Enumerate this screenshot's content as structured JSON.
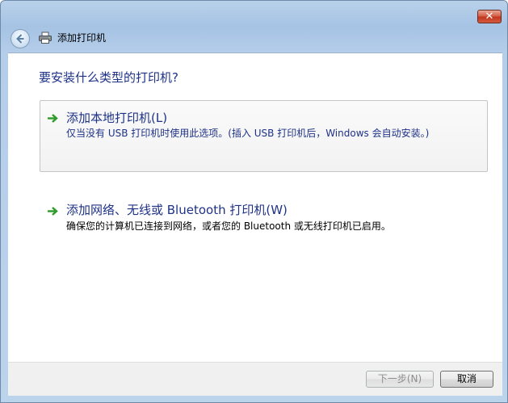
{
  "window": {
    "title": "添加打印机",
    "close_glyph": "✕"
  },
  "icons": {
    "back": "back-arrow-icon",
    "printer": "printer-icon",
    "option_arrow": "green-arrow-icon",
    "close": "close-icon"
  },
  "colors": {
    "accent_text": "#1e3287",
    "arrow_green": "#2e9a2a",
    "close_red": "#c0361d"
  },
  "main": {
    "heading": "要安装什么类型的打印机?",
    "options": [
      {
        "title": "添加本地打印机(L)",
        "description": "仅当没有 USB 打印机时使用此选项。(插入 USB 打印机后，Windows 会自动安装。)"
      },
      {
        "title": "添加网络、无线或 Bluetooth 打印机(W)",
        "description": "确保您的计算机已连接到网络，或者您的 Bluetooth 或无线打印机已启用。"
      }
    ]
  },
  "footer": {
    "next_label": "下一步(N)",
    "cancel_label": "取消"
  }
}
